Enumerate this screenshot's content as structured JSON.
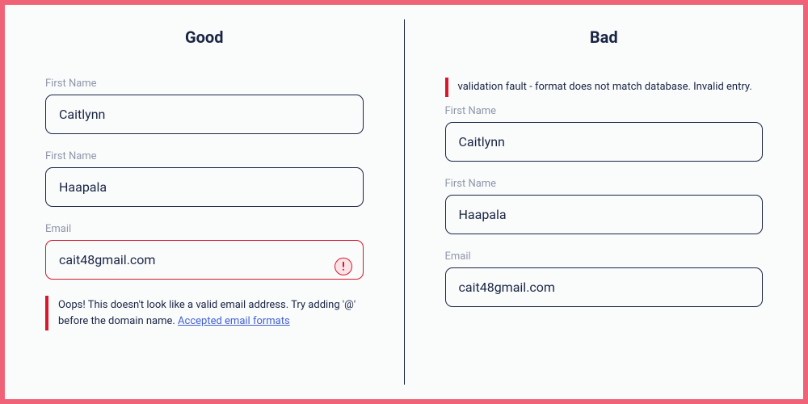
{
  "good": {
    "title": "Good",
    "first_name_label": "First Name",
    "first_name_value": "Caitlynn",
    "last_name_label": "First Name",
    "last_name_value": "Haapala",
    "email_label": "Email",
    "email_value": "cait48gmail.com",
    "error_text": "Oops! This doesn't look like a valid email address. Try adding '@' before the domain name. ",
    "error_link": "Accepted email formats"
  },
  "bad": {
    "title": "Bad",
    "error_text": "validation fault - format does not match database. Invalid entry.",
    "first_name_label": "First Name",
    "first_name_value": "Caitlynn",
    "last_name_label": "First Name",
    "last_name_value": "Haapala",
    "email_label": "Email",
    "email_value": "cait48gmail.com"
  }
}
